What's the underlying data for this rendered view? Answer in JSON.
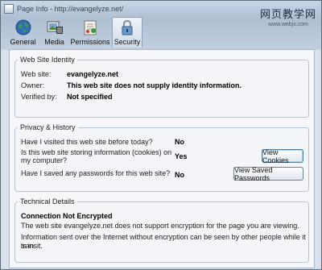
{
  "window": {
    "title": "Page Info - http://evangelyze.net/"
  },
  "watermark": {
    "chinese": "网页教学网",
    "url": "www.webjx.com"
  },
  "tabs": [
    {
      "label": "General",
      "icon": "globe-icon"
    },
    {
      "label": "Media",
      "icon": "media-icon"
    },
    {
      "label": "Permissions",
      "icon": "permissions-icon"
    },
    {
      "label": "Security",
      "icon": "padlock-icon",
      "active": true
    }
  ],
  "identity": {
    "legend": "Web Site Identity",
    "website_label": "Web site:",
    "website_value": "evangelyze.net",
    "owner_label": "Owner:",
    "owner_value": "This web site does not supply identity information.",
    "verified_label": "Verified by:",
    "verified_value": "Not specified"
  },
  "privacy": {
    "legend": "Privacy & History",
    "q1": "Have I visited this web site before today?",
    "a1": "No",
    "q2_line1": "Is this web site storing information (cookies) on",
    "q2_line2": "my computer?",
    "a2": "Yes",
    "view_cookies": "View Cookies",
    "q3": "Have I saved any passwords for this web site?",
    "a3": "No",
    "view_passwords": "View Saved Passwords"
  },
  "technical": {
    "legend": "Technical Details",
    "heading": "Connection Not Encrypted",
    "line1": "The web site evangelyze.net does not support encryption for the page you are viewing.",
    "line2a": "Information sent over the Internet without encryption can be seen by other people while it is in",
    "line2b": "transit."
  }
}
